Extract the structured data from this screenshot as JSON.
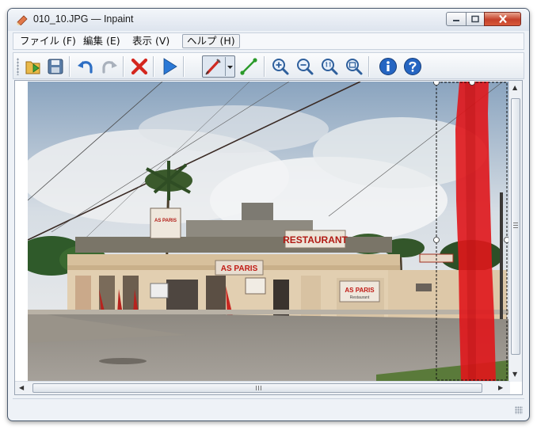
{
  "window": {
    "title": "010_10.JPG — Inpaint"
  },
  "menu": [
    {
      "label": "ファイル (F)"
    },
    {
      "label": "編集 (E)"
    },
    {
      "label": "表示 (V)"
    },
    {
      "label": "ヘルプ (H)",
      "active": true
    }
  ],
  "toolbar": {
    "buttons": [
      "open-icon",
      "save-icon",
      "undo-icon",
      "redo-icon",
      "erase-selection-icon",
      "run-icon",
      "marker-icon",
      "dropdown-arrow-icon",
      "line-tool-icon",
      "zoom-in-icon",
      "zoom-out-icon",
      "zoom-actual-icon",
      "zoom-fit-icon",
      "info-icon",
      "help-icon"
    ]
  },
  "canvas": {
    "sign_main": "RESTAURANT",
    "sign_left": "AS PARIS",
    "sign_center": "AS PARIS",
    "sign_right": "AS PARIS",
    "sign_right_sub": "Restaurant",
    "selection_color": "#e0161b"
  },
  "colors": {
    "accent": "#1f6fd6",
    "close": "#c5412a"
  }
}
